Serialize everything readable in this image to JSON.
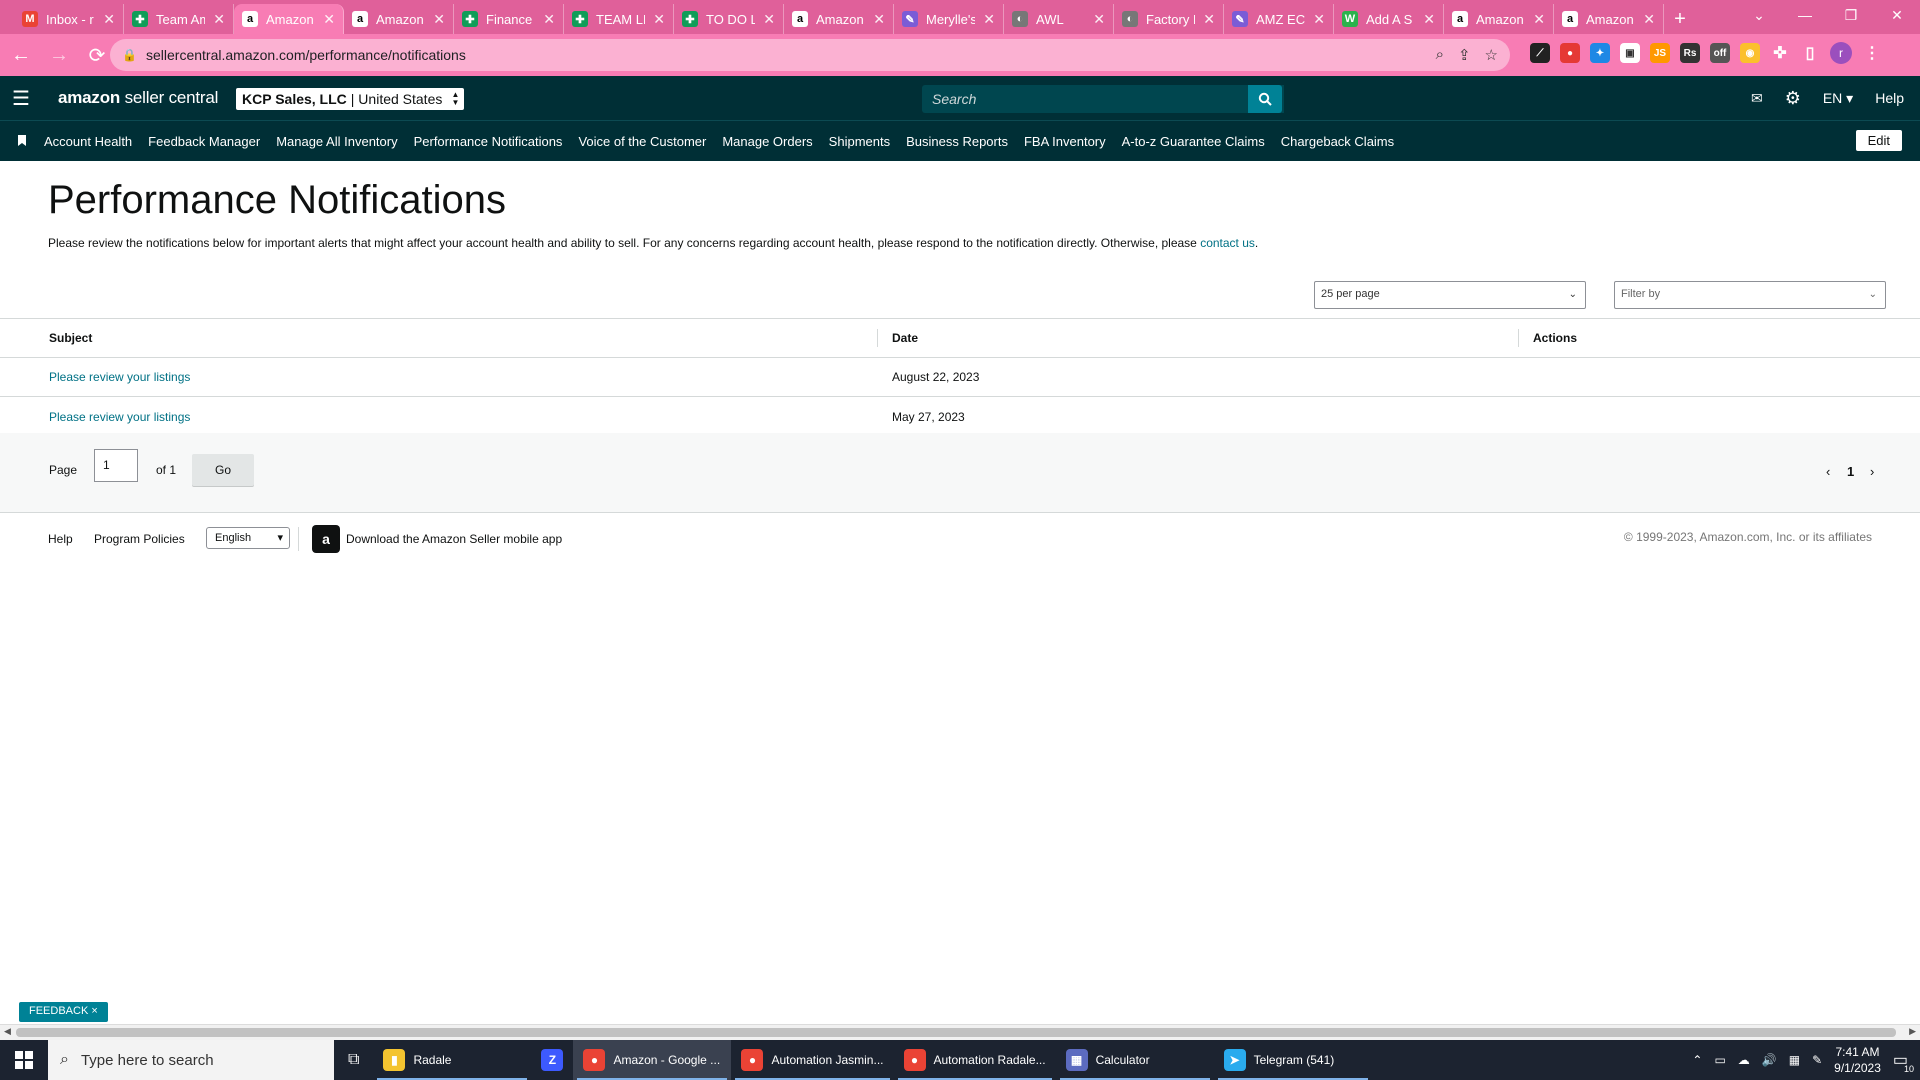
{
  "browser": {
    "tabs": [
      {
        "title": "Inbox - r",
        "fav_color": "#ea4335",
        "fav_glyph": "M",
        "active": false
      },
      {
        "title": "Team Am",
        "fav_color": "#0f9d58",
        "fav_glyph": "✚",
        "active": false
      },
      {
        "title": "Amazon",
        "fav_color": "#ffffff",
        "fav_glyph": "a",
        "active": true
      },
      {
        "title": "Amazon",
        "fav_color": "#ffffff",
        "fav_glyph": "a",
        "active": false
      },
      {
        "title": "Finance",
        "fav_color": "#0f9d58",
        "fav_glyph": "✚",
        "active": false
      },
      {
        "title": "TEAM LE",
        "fav_color": "#0f9d58",
        "fav_glyph": "✚",
        "active": false
      },
      {
        "title": "TO DO L",
        "fav_color": "#0f9d58",
        "fav_glyph": "✚",
        "active": false
      },
      {
        "title": "Amazon",
        "fav_color": "#ffffff",
        "fav_glyph": "a",
        "active": false
      },
      {
        "title": "Merylle's",
        "fav_color": "#7b5cd6",
        "fav_glyph": "✎",
        "active": false
      },
      {
        "title": "AWL",
        "fav_color": "#777777",
        "fav_glyph": "◐",
        "active": false
      },
      {
        "title": "Factory D",
        "fav_color": "#777777",
        "fav_glyph": "◐",
        "active": false
      },
      {
        "title": "AMZ EC",
        "fav_color": "#7b5cd6",
        "fav_glyph": "✎",
        "active": false
      },
      {
        "title": "Add A S",
        "fav_color": "#2bb24c",
        "fav_glyph": "W",
        "active": false
      },
      {
        "title": "Amazon",
        "fav_color": "#ffffff",
        "fav_glyph": "a",
        "active": false
      },
      {
        "title": "Amazon",
        "fav_color": "#ffffff",
        "fav_glyph": "a",
        "active": false
      }
    ],
    "url": "sellercentral.amazon.com/performance/notifications",
    "toolbar_color": "#f87cb4",
    "tabstrip_color": "#e0609a"
  },
  "header": {
    "logo_bold": "amazon",
    "logo_rest": " seller central",
    "account_name": "KCP Sales, LLC",
    "account_region": "| United States",
    "search_placeholder": "Search",
    "language": "EN",
    "help": "Help"
  },
  "nav": {
    "items": [
      "Account Health",
      "Feedback Manager",
      "Manage All Inventory",
      "Performance Notifications",
      "Voice of the Customer",
      "Manage Orders",
      "Shipments",
      "Business Reports",
      "FBA Inventory",
      "A-to-z Guarantee Claims",
      "Chargeback Claims"
    ],
    "edit": "Edit"
  },
  "main": {
    "title": "Performance Notifications",
    "intro": "Please review the notifications below for important alerts that might affect your account health and ability to sell. For any concerns regarding account health, please respond to the notification directly. Otherwise, please ",
    "contact_link": "contact us",
    "intro_end": ".",
    "per_page": "25 per page",
    "filter_placeholder": "Filter by",
    "table": {
      "headers": {
        "subject": "Subject",
        "date": "Date",
        "actions": "Actions"
      },
      "rows": [
        {
          "subject": "Please review your listings",
          "date": "August 22, 2023"
        },
        {
          "subject": "Please review your listings",
          "date": "May 27, 2023"
        }
      ]
    },
    "pager": {
      "page_label": "Page",
      "page_value": "1",
      "of_label": "of 1",
      "go": "Go",
      "current": "1"
    }
  },
  "footer": {
    "help": "Help",
    "policies": "Program Policies",
    "language": "English",
    "app_text": "Download the Amazon Seller mobile app",
    "copyright": "© 1999-2023, Amazon.com, Inc. or its affiliates",
    "feedback": "FEEDBACK"
  },
  "taskbar": {
    "search_placeholder": "Type here to search",
    "apps": [
      {
        "label": "Radale",
        "icon_color": "#f4c430",
        "glyph": "▮",
        "open": true,
        "sel": false
      },
      {
        "label": "",
        "icon_color": "#3d5afe",
        "glyph": "Z",
        "open": false,
        "sel": false
      },
      {
        "label": "Amazon - Google ...",
        "icon_color": "#ea4335",
        "glyph": "●",
        "open": true,
        "sel": true
      },
      {
        "label": "Automation Jasmin...",
        "icon_color": "#ea4335",
        "glyph": "●",
        "open": true,
        "sel": false
      },
      {
        "label": "Automation Radale...",
        "icon_color": "#ea4335",
        "glyph": "●",
        "open": true,
        "sel": false
      },
      {
        "label": "Calculator",
        "icon_color": "#5c6bc0",
        "glyph": "▦",
        "open": true,
        "sel": false
      },
      {
        "label": "Telegram (541)",
        "icon_color": "#2aabee",
        "glyph": "➤",
        "open": true,
        "sel": false
      }
    ],
    "time": "7:41 AM",
    "date": "9/1/2023",
    "notifications": "10"
  }
}
